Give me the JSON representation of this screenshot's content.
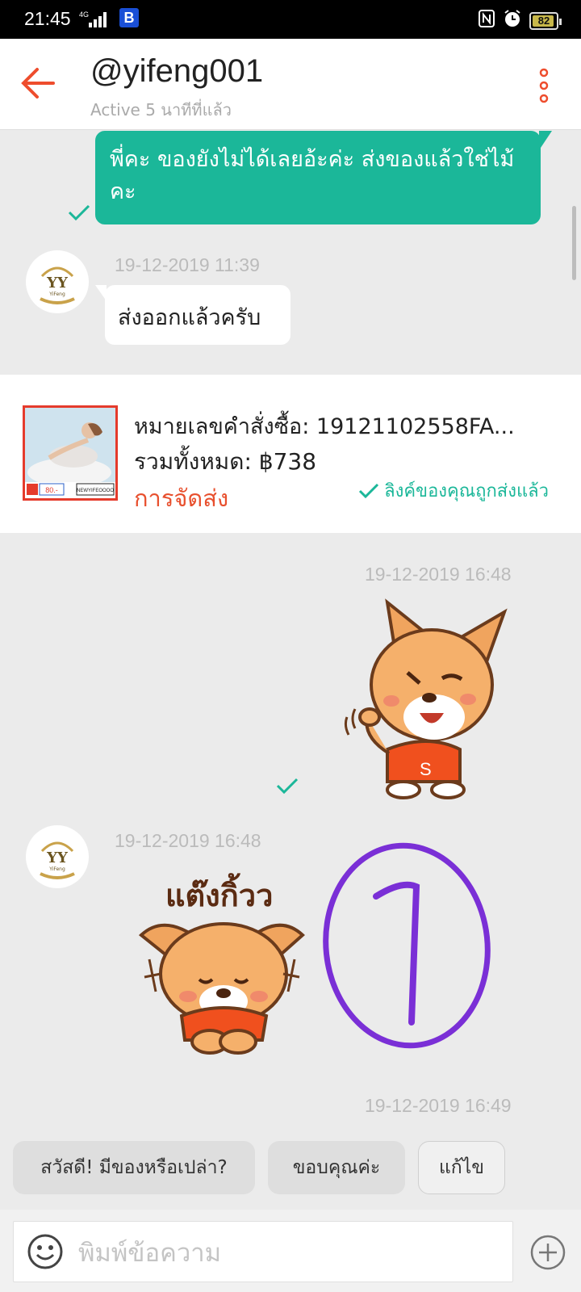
{
  "status_bar": {
    "time": "21:45",
    "network": "4G",
    "app_badge": "B",
    "battery": "82",
    "battery_level": 0.82
  },
  "header": {
    "title": "@yifeng001",
    "status": "Active 5 นาทีที่แล้ว",
    "accent_color": "#ee4d2d"
  },
  "messages": {
    "msg1": {
      "text": "พี่คะ ของยังไม่ได้เลยอ้ะค่ะ ส่งของแล้วใช่ไม้คะ"
    },
    "msg2": {
      "timestamp": "19-12-2019 11:39",
      "text": "ส่งออกแล้วครับ"
    },
    "order": {
      "number_label": "หมายเลขคำสั่งซื้อ: 19121102558FA...",
      "total_label": "รวมทั้งหมด: ฿738",
      "status": "การจัดส่ง",
      "link_sent": "ลิงค์ของคุณถูกส่งแล้ว",
      "thumb_badge_price": "80.-",
      "thumb_badge_code": "NEWYIFEOOOO"
    },
    "msg3": {
      "timestamp": "19-12-2019 16:48",
      "sticker": "waving-dog-sticker",
      "shirt_letter": "S"
    },
    "msg4": {
      "timestamp": "19-12-2019 16:48",
      "sticker_caption": "แต๊งกิ้วว",
      "sticker": "thank-you-dog-sticker",
      "annotation": "1"
    },
    "msg5_timestamp_partial": "19-12-2019 16:49"
  },
  "avatar": {
    "text": "YY",
    "sub": "YiFeng"
  },
  "quick_replies": [
    "สวัสดี! มีของหรือเปล่า?",
    "ขอบคุณค่ะ",
    "แก้ไข"
  ],
  "input": {
    "placeholder": "พิมพ์ข้อความ"
  },
  "colors": {
    "outgoing_bubble": "#1bb799",
    "accent": "#ee4d2d",
    "annotation": "#7a2fd6"
  }
}
